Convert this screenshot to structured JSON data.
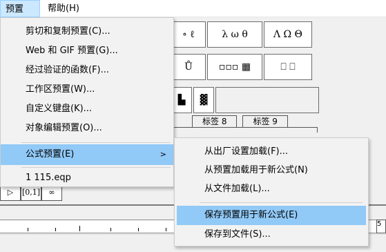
{
  "menubar": {
    "items": [
      {
        "label": "预置(P)",
        "active": true
      },
      {
        "label": "帮助(H)",
        "active": false
      }
    ]
  },
  "palette": {
    "row1": [
      "∘ ℓ",
      "λ ω θ",
      "Λ Ω Θ"
    ],
    "row2": [
      "Ů",
      "▫▫▫ ▦",
      "⎕ ⎕"
    ],
    "row3": [
      "▙",
      "▓"
    ]
  },
  "tabs": [
    "标签 8",
    "标签 9"
  ],
  "bottom_palette": [
    "▷",
    "[0,1]",
    "∞"
  ],
  "ruler_right": "5",
  "menu_main": {
    "items": [
      {
        "label": "剪切和复制预置(C)..."
      },
      {
        "label": "Web 和 GIF 预置(G)..."
      },
      {
        "label": "经过验证的函数(F)..."
      },
      {
        "label": "工作区预置(W)..."
      },
      {
        "label": "自定义键盘(K)..."
      },
      {
        "label": "对象编辑预置(O)..."
      },
      {
        "label": "公式预置(E)",
        "submenu": true,
        "highlighted": true
      },
      {
        "label": "1 115.eqp"
      }
    ],
    "submenu_arrow": ">"
  },
  "menu_sub": {
    "items": [
      {
        "label": "从出厂设置加载(F)..."
      },
      {
        "label": "从预置加载用于新公式(N)"
      },
      {
        "label": "从文件加载(L)..."
      },
      {
        "label": "保存预置用于新公式(E)",
        "highlighted": true
      },
      {
        "label": "保存到文件(S)..."
      }
    ]
  },
  "colors": {
    "menu_bg": "#f2f2f2",
    "highlight": "#91c9f7",
    "menubar_active": "#cce8ff"
  }
}
